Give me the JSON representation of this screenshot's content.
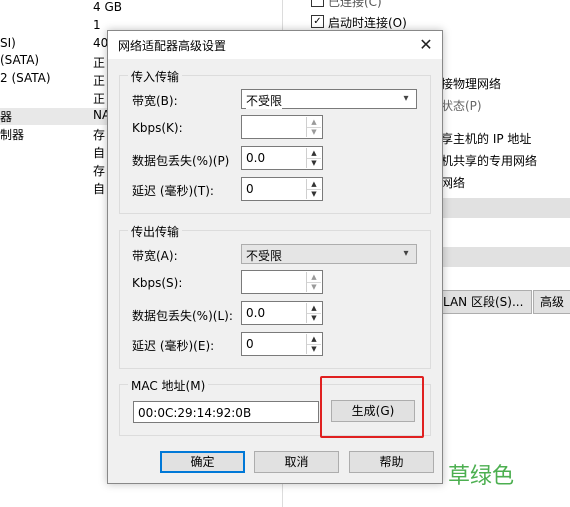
{
  "background": {
    "left_column": [
      "SI)",
      "(SATA)",
      "2 (SATA)",
      "器",
      "制器"
    ],
    "middle_column": [
      "4 GB",
      "1",
      "40",
      "正",
      "正",
      "正",
      "NA",
      "存",
      "自",
      "存",
      "自"
    ],
    "right_top": {
      "connected_label": "已连接(C)",
      "autoconnect_label": "启动时连接(O)",
      "autoconnect_check": "✓"
    },
    "right_items": [
      "接物理网络",
      "状态(P)",
      "享主机的 IP 地址",
      "机共享的专用网络",
      "网络"
    ],
    "lan_button": "LAN 区段(S)...",
    "advanced_button": "高级"
  },
  "dialog": {
    "title": "网络适配器高级设置",
    "close_icon": "✕",
    "incoming": {
      "group_label": "传入传输",
      "bandwidth_label": "带宽(B):",
      "bandwidth_value": "不受限",
      "kbps_label": "Kbps(K):",
      "kbps_value": "",
      "packet_loss_label": "数据包丢失(%)(P)",
      "packet_loss_value": "0.0",
      "latency_label": "延迟 (毫秒)(T):",
      "latency_value": "0"
    },
    "outgoing": {
      "group_label": "传出传输",
      "bandwidth_label": "带宽(A):",
      "bandwidth_value": "不受限",
      "kbps_label": "Kbps(S):",
      "kbps_value": "",
      "packet_loss_label": "数据包丢失(%)(L):",
      "packet_loss_value": "0.0",
      "latency_label": "延迟 (毫秒)(E):",
      "latency_value": "0"
    },
    "mac": {
      "group_label": "MAC 地址(M)",
      "value": "00:0C:29:14:92:0B",
      "generate_button": "生成(G)"
    },
    "buttons": {
      "ok": "确定",
      "cancel": "取消",
      "help": "帮助"
    }
  },
  "annotation_text": "草绿色",
  "colors": {
    "highlight_box": "#e02020",
    "annotation": "#4caf50",
    "default_button_border": "#0078d7"
  }
}
